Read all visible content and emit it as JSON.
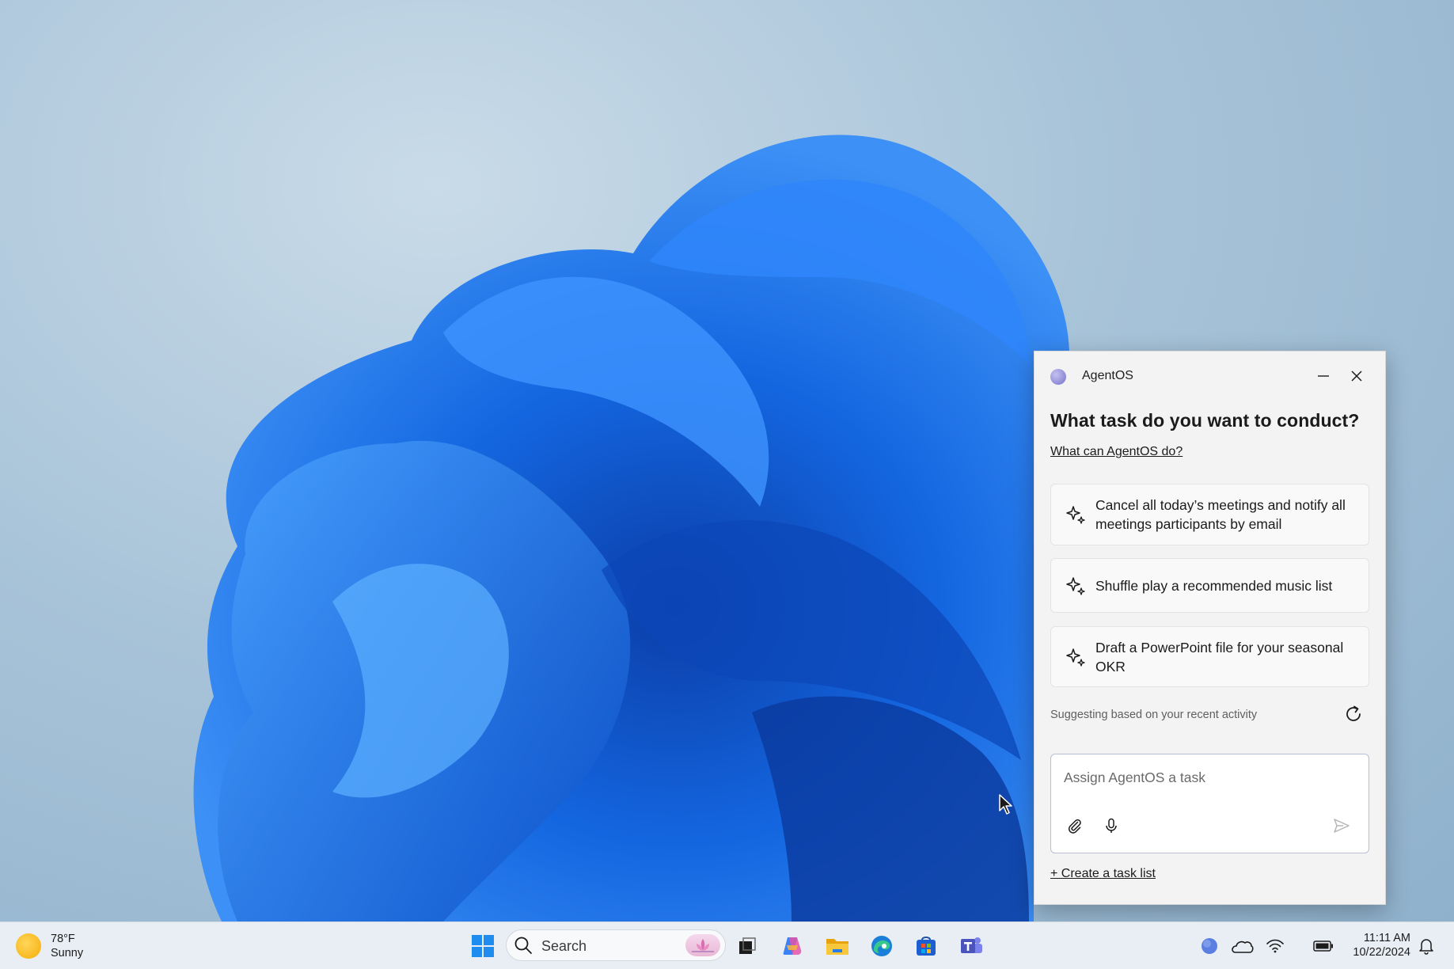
{
  "agent_panel": {
    "title": "AgentOS",
    "heading": "What task do you want to conduct?",
    "help_link": "What can AgentOS do?",
    "suggestions": [
      {
        "text": "Cancel all today’s meetings and notify all meetings participants by email",
        "icon": "sparkle-icon"
      },
      {
        "text": "Shuffle play a recommended music list",
        "icon": "sparkle-icon"
      },
      {
        "text": "Draft a PowerPoint file for your seasonal OKR",
        "icon": "sparkle-icon"
      }
    ],
    "suggest_note": "Suggesting based on your recent activity",
    "input": {
      "placeholder": "Assign AgentOS a task",
      "value": ""
    },
    "create_list_link": "+ Create a task list"
  },
  "taskbar": {
    "weather": {
      "temp": "78°F",
      "condition": "Sunny",
      "icon": "sun-icon"
    },
    "search_label": "Search",
    "apps": [
      "start-icon",
      "task-view-icon",
      "copilot-icon",
      "file-explorer-icon",
      "edge-icon",
      "store-icon",
      "teams-icon"
    ],
    "tray": [
      "agentos-tray-icon",
      "onedrive-icon",
      "wifi-icon",
      "battery-icon",
      "notification-icon"
    ],
    "clock": {
      "time": "11:11 AM",
      "date": "10/22/2024"
    }
  },
  "colors": {
    "wallpaper_blue": "#1a6fe8",
    "panel_bg": "#f3f3f3",
    "taskbar_bg": "#e9eef4",
    "agent_dot": "#8d8ad6"
  }
}
